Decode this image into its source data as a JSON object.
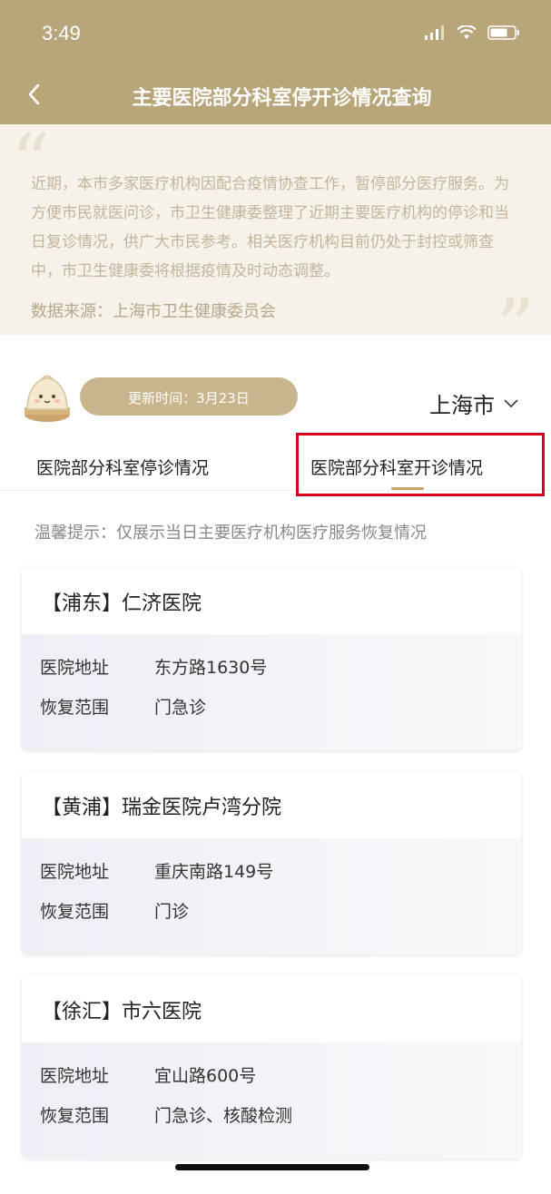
{
  "status": {
    "time": "3:49"
  },
  "nav": {
    "title": "主要医院部分科室停开诊情况查询"
  },
  "intro": {
    "text": "近期，本市多家医疗机构因配合疫情协查工作，暂停部分医疗服务。为方便市民就医问诊，市卫生健康委整理了近期主要医疗机构的停诊和当日复诊情况，供广大市民参考。相关医疗机构目前仍处于封控或筛查中，市卫生健康委将根据疫情及时动态调整。",
    "source": "数据来源：上海市卫生健康委员会"
  },
  "update_time": "更新时间：3月23日",
  "city": "上海市",
  "tabs": [
    {
      "label": "医院部分科室停诊情况"
    },
    {
      "label": "医院部分科室开诊情况"
    }
  ],
  "tip": "温馨提示：仅展示当日主要医疗机构医疗服务恢复情况",
  "field_labels": {
    "address": "医院地址",
    "scope": "恢复范围"
  },
  "hospitals": [
    {
      "title": "【浦东】仁济医院",
      "address": "东方路1630号",
      "scope": "门急诊"
    },
    {
      "title": "【黄浦】瑞金医院卢湾分院",
      "address": "重庆南路149号",
      "scope": "门诊"
    },
    {
      "title": "【徐汇】市六医院",
      "address": "宜山路600号",
      "scope": "门急诊、核酸检测"
    }
  ],
  "colors": {
    "header": "#b8a57a",
    "accent": "#c8a66a",
    "highlight": "#d9001b"
  }
}
